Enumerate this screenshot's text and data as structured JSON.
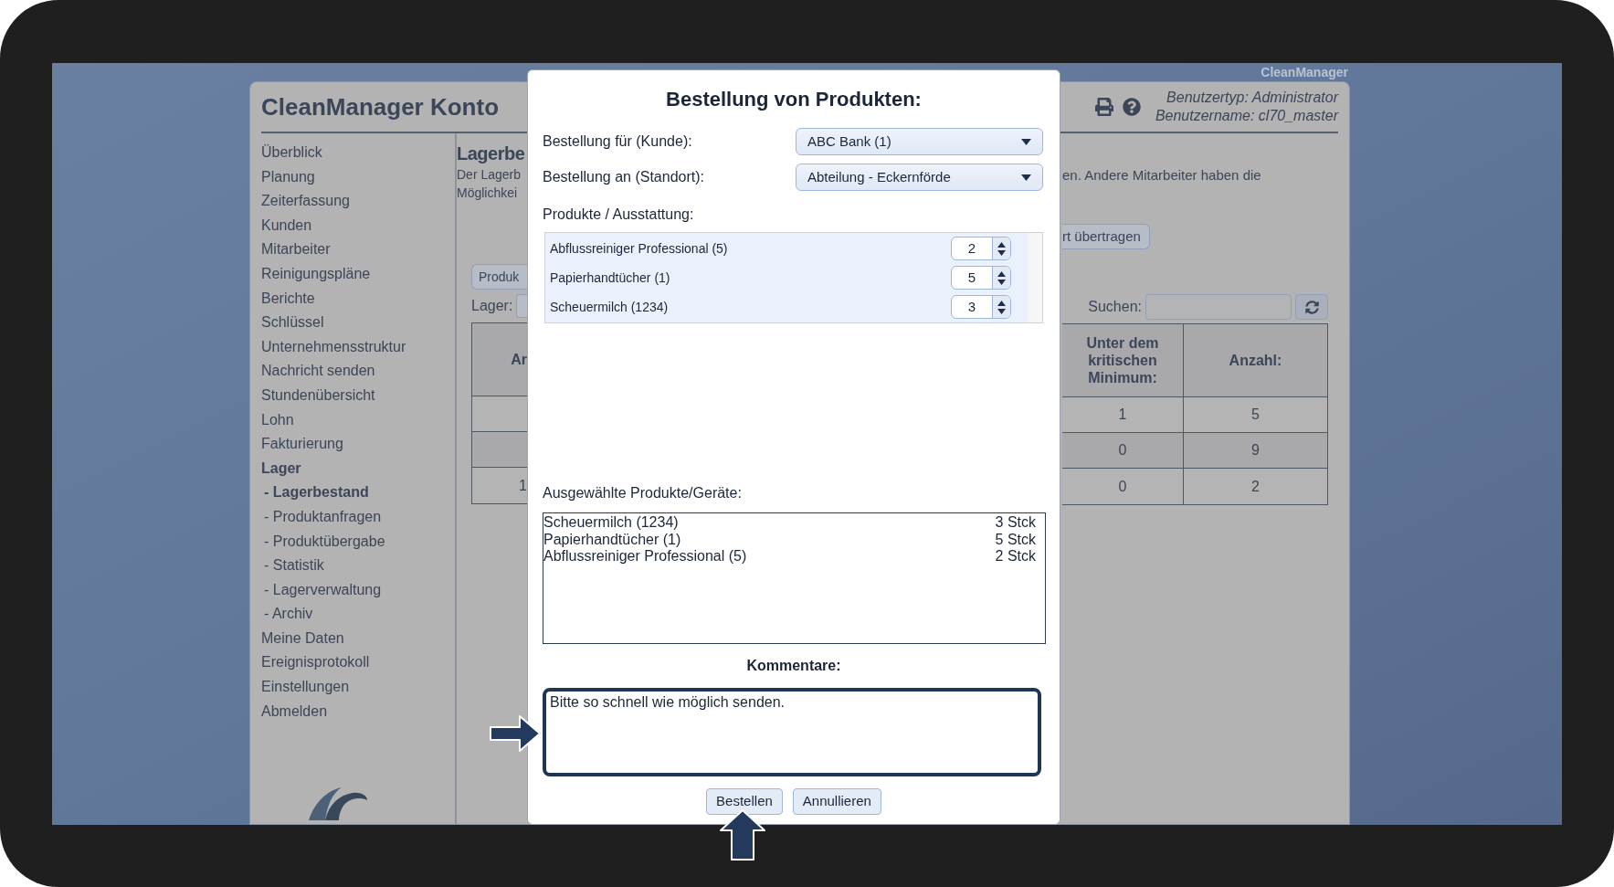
{
  "screen_label": "CleanManager",
  "header": {
    "title": "CleanManager Konto",
    "user_type": "Benutzertyp: Administrator",
    "username": "Benutzername: cl70_master"
  },
  "sidebar": {
    "items": [
      {
        "label": "Überblick",
        "expanded": false
      },
      {
        "label": "Planung",
        "expanded": false
      },
      {
        "label": "Zeiterfassung",
        "expanded": false
      },
      {
        "label": "Kunden",
        "expanded": false
      },
      {
        "label": "Mitarbeiter",
        "expanded": false
      },
      {
        "label": "Reinigungspläne",
        "expanded": false
      },
      {
        "label": "Berichte",
        "expanded": false
      },
      {
        "label": "Schlüssel",
        "expanded": false
      },
      {
        "label": "Unternehmensstruktur",
        "expanded": false
      },
      {
        "label": "Nachricht senden",
        "expanded": false
      },
      {
        "label": "Stundenübersicht",
        "expanded": false
      },
      {
        "label": "Lohn",
        "expanded": false
      },
      {
        "label": "Fakturierung",
        "expanded": false
      },
      {
        "label": "Lager",
        "expanded": true,
        "children": [
          {
            "label": "- Lagerbestand",
            "selected": true
          },
          {
            "label": "- Produktanfragen",
            "selected": false
          },
          {
            "label": "- Produktübergabe",
            "selected": false
          },
          {
            "label": "- Statistik",
            "selected": false
          },
          {
            "label": "- Lagerverwaltung",
            "selected": false
          },
          {
            "label": "- Archiv",
            "selected": false
          }
        ]
      },
      {
        "label": "Meine Daten",
        "expanded": false
      },
      {
        "label": "Ereignisprotokoll",
        "expanded": false
      },
      {
        "label": "Einstellungen",
        "expanded": false
      },
      {
        "label": "Abmelden",
        "expanded": false
      }
    ]
  },
  "content": {
    "heading": "Lagerbe",
    "description_left": [
      "Der Lagerb",
      "Möglichkei"
    ],
    "description_right": "en. Andere Mitarbeiter haben die",
    "transfer_button": "rt übertragen",
    "tab_button": "Produk",
    "lager_label": "Lager:",
    "search_label": "Suchen:",
    "table": {
      "columns": [
        "Ar",
        "Unter dem kritischen Minimum:",
        "Anzahl:"
      ],
      "rows": [
        {
          "critical": "1",
          "count": "5"
        },
        {
          "critical": "0",
          "count": "9"
        },
        {
          "first": "1",
          "critical": "0",
          "count": "2"
        }
      ]
    }
  },
  "modal": {
    "title": "Bestellung von Produkten:",
    "fields": [
      {
        "label": "Bestellung für (Kunde):",
        "value": "ABC Bank (1)"
      },
      {
        "label": "Bestellung an (Standort):",
        "value": "Abteilung - Eckernförde"
      }
    ],
    "products_label": "Produkte / Ausstattung:",
    "products": [
      {
        "name": "Abflussreiniger Professional (5)",
        "quantity": "2"
      },
      {
        "name": "Papierhandtücher (1)",
        "quantity": "5"
      },
      {
        "name": "Scheuermilch (1234)",
        "quantity": "3"
      }
    ],
    "selected_label": "Ausgewählte Produkte/Geräte:",
    "selected_items": [
      {
        "name": "Scheuermilch (1234)",
        "amount": "3 Stck"
      },
      {
        "name": "Papierhandtücher (1)",
        "amount": "5 Stck"
      },
      {
        "name": "Abflussreiniger Professional (5)",
        "amount": "2 Stck"
      }
    ],
    "comment_label": "Kommentare:",
    "comment": "Bitte so schnell wie möglich senden.",
    "buttons": [
      "Bestellen",
      "Annullieren"
    ]
  }
}
